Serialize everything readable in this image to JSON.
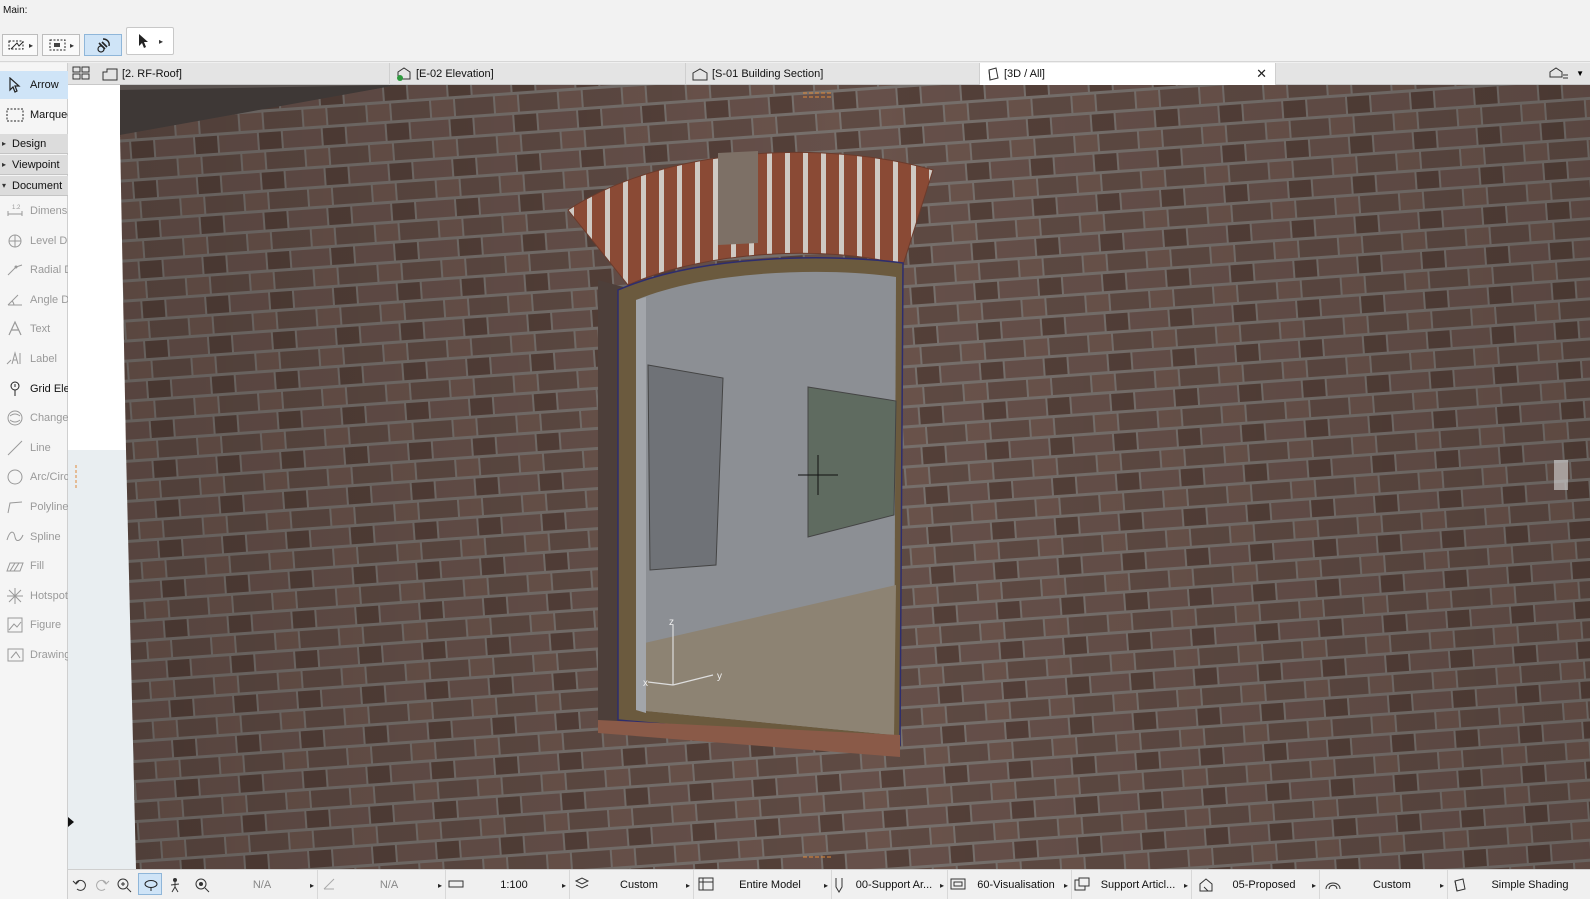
{
  "toolbar": {
    "title": "Main:"
  },
  "tabs": [
    {
      "label": "[2. RF-Roof]",
      "active": false
    },
    {
      "label": "[E-02 Elevation]",
      "active": false
    },
    {
      "label": "[S-01 Building Section]",
      "active": false
    },
    {
      "label": "[3D / All]",
      "active": true,
      "close": "✕"
    }
  ],
  "toolbox": {
    "items_top": [
      {
        "label": "Arrow",
        "icon": "arrow-icon",
        "state": "selected"
      },
      {
        "label": "Marquee",
        "icon": "marquee-icon",
        "state": "enabled"
      }
    ],
    "sections": [
      {
        "label": "Design",
        "open": false
      },
      {
        "label": "Viewpoint",
        "open": false
      },
      {
        "label": "Document",
        "open": true
      }
    ],
    "document_items": [
      {
        "label": "Dimension",
        "icon": "dimension-icon",
        "state": "disabled"
      },
      {
        "label": "Level Dimension",
        "icon": "level-dimension-icon",
        "state": "disabled"
      },
      {
        "label": "Radial Dimension",
        "icon": "radial-dimension-icon",
        "state": "disabled"
      },
      {
        "label": "Angle Dimension",
        "icon": "angle-dimension-icon",
        "state": "disabled"
      },
      {
        "label": "Text",
        "icon": "text-icon",
        "state": "disabled"
      },
      {
        "label": "Label",
        "icon": "label-icon",
        "state": "disabled"
      },
      {
        "label": "Grid Element",
        "icon": "grid-element-icon",
        "state": "enabled"
      },
      {
        "label": "Change",
        "icon": "change-icon",
        "state": "disabled"
      },
      {
        "label": "Line",
        "icon": "line-icon",
        "state": "disabled"
      },
      {
        "label": "Arc/Circle",
        "icon": "arc-icon",
        "state": "disabled"
      },
      {
        "label": "Polyline",
        "icon": "polyline-icon",
        "state": "disabled"
      },
      {
        "label": "Spline",
        "icon": "spline-icon",
        "state": "disabled"
      },
      {
        "label": "Fill",
        "icon": "fill-icon",
        "state": "disabled"
      },
      {
        "label": "Hotspot",
        "icon": "hotspot-icon",
        "state": "disabled"
      },
      {
        "label": "Figure",
        "icon": "figure-icon",
        "state": "disabled"
      },
      {
        "label": "Drawing",
        "icon": "drawing-icon",
        "state": "disabled"
      }
    ]
  },
  "viewport": {
    "axis_z": "z",
    "axis_y": "y",
    "axis_x": "x",
    "colors": {
      "brick": "#5e4a43",
      "mortar": "#8a8380",
      "frame": "#6b5a3e",
      "interior_wall": "#8c8f94",
      "floor": "#8d8373",
      "arch_brick": "#8a4a35"
    }
  },
  "statusbar": {
    "na1": "N/A",
    "na2": "N/A",
    "scale": "1:100",
    "pen_set": "Custom",
    "model_view": "Entire Model",
    "layer_combo": "00-Support Ar...",
    "renovation_filter": "60-Visualisation",
    "graphic_override": "Support Articl...",
    "structural": "05-Proposed",
    "partial_structure": "Custom",
    "shading": "Simple Shading"
  }
}
